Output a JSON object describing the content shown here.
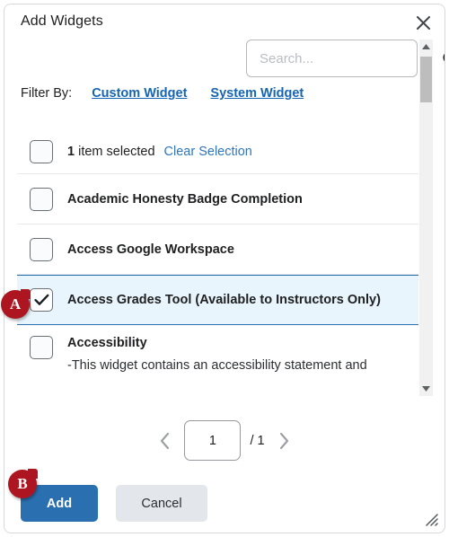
{
  "dialog": {
    "title": "Add Widgets",
    "close_icon": "close-icon"
  },
  "search": {
    "value": "",
    "placeholder": "Search...",
    "icon": "search-icon"
  },
  "filter": {
    "label": "Filter By:",
    "links": [
      {
        "label": "Custom Widget"
      },
      {
        "label": "System Widget"
      }
    ]
  },
  "list": {
    "header": {
      "count": "1",
      "count_text": " item selected",
      "clear_label": "Clear Selection",
      "checked": false
    },
    "rows": [
      {
        "label": "Academic Honesty Badge Completion",
        "checked": false,
        "selected": false,
        "description": ""
      },
      {
        "label": "Access Google Workspace",
        "checked": false,
        "selected": false,
        "description": ""
      },
      {
        "label": "Access Grades Tool (Available to Instructors Only)",
        "checked": true,
        "selected": true,
        "description": ""
      },
      {
        "label": "Accessibility",
        "checked": false,
        "selected": false,
        "description": "-This widget contains an accessibility statement and"
      }
    ]
  },
  "scrollbar": {
    "up_icon": "triangle-up-icon",
    "down_icon": "triangle-down-icon"
  },
  "pagination": {
    "prev_icon": "chevron-left-icon",
    "next_icon": "chevron-right-icon",
    "current_page": "1",
    "total_label": "/ 1"
  },
  "footer": {
    "add_label": "Add",
    "cancel_label": "Cancel",
    "resize_icon": "resize-grip-icon"
  },
  "annotations": [
    {
      "id": "A",
      "label": "A"
    },
    {
      "id": "B",
      "label": "B"
    }
  ],
  "colors": {
    "primary": "#2a6fb0",
    "link": "#1464b4",
    "selected_row_bg": "#e8f5fd",
    "badge": "#ad1620"
  }
}
